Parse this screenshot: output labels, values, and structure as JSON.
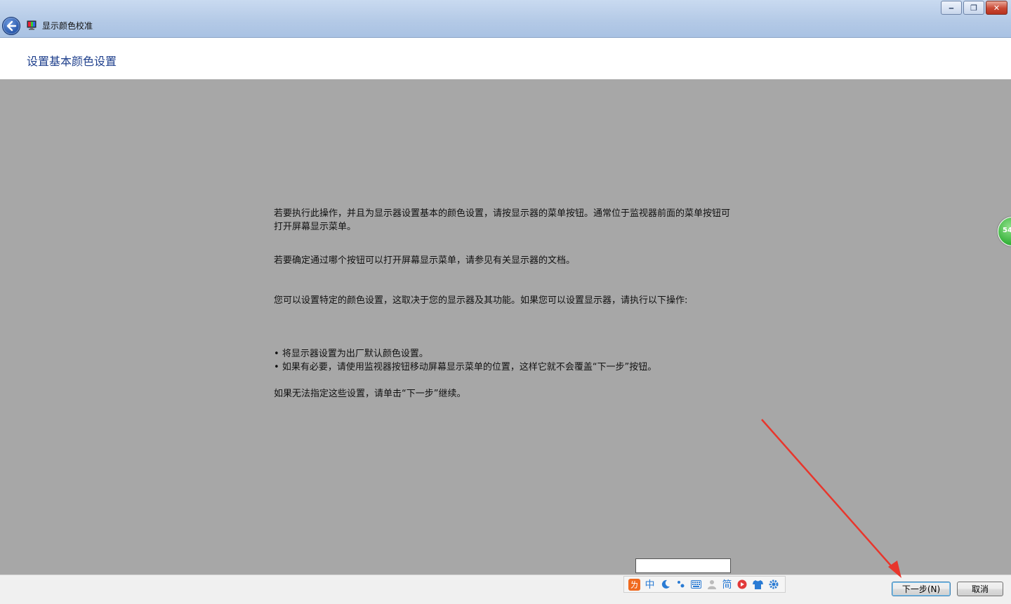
{
  "window": {
    "title": "显示颜色校准",
    "controls": {
      "minimize": "‒",
      "maximize": "❐",
      "close": "✕"
    }
  },
  "header": {
    "title": "设置基本颜色设置"
  },
  "content": {
    "para1": "若要执行此操作，并且为显示器设置基本的颜色设置，请按显示器的菜单按钮。通常位于监视器前面的菜单按钮可打开屏幕显示菜单。",
    "para2": "若要确定通过哪个按钮可以打开屏幕显示菜单，请参见有关显示器的文档。",
    "para3": "您可以设置特定的颜色设置，这取决于您的显示器及其功能。如果您可以设置显示器，请执行以下操作:",
    "bullets": [
      "将显示器设置为出厂默认颜色设置。",
      "如果有必要，请使用监视器按钮移动屏幕显示菜单的位置，这样它就不会覆盖“下一步”按钮。"
    ],
    "para4": "如果无法指定这些设置，请单击“下一步”继续。"
  },
  "side_badge": {
    "text": "54"
  },
  "ime": {
    "input_value": "",
    "logo": "ㄌ",
    "mode": "中",
    "icons": [
      "moon-icon",
      "punctuation-icon",
      "keyboard-icon",
      "user-icon",
      "simplified-icon",
      "video-icon",
      "skin-icon",
      "settings-icon"
    ],
    "simplified": "简"
  },
  "buttons": {
    "next": "下一步(N)",
    "cancel": "取消"
  },
  "colors": {
    "accent": "#1e3f8c",
    "annotation_arrow": "#e8362c"
  }
}
